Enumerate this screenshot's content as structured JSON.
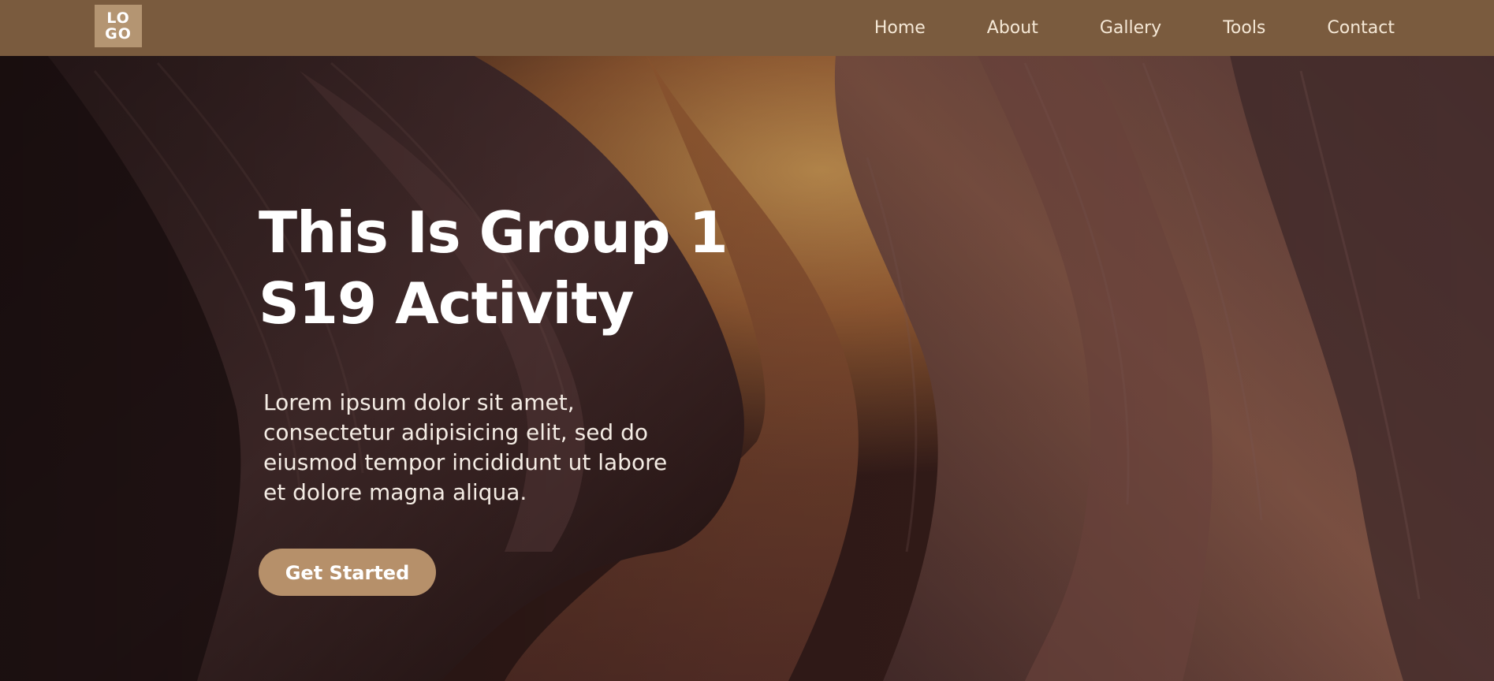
{
  "logo": {
    "line1": "LO",
    "line2": "GO"
  },
  "nav": {
    "items": [
      {
        "label": "Home"
      },
      {
        "label": "About"
      },
      {
        "label": "Gallery"
      },
      {
        "label": "Tools"
      },
      {
        "label": "Contact"
      }
    ]
  },
  "hero": {
    "title_line1": "This Is Group 1",
    "title_line2": "S19 Activity",
    "description": "Lorem ipsum dolor sit amet, consectetur adipisicing elit, sed do eiusmod tempor incididunt ut labore et dolore magna aliqua.",
    "cta_label": "Get Started"
  },
  "colors": {
    "navbar": "#7a5b3e",
    "logo_bg": "#b49572",
    "button": "#b6906a",
    "nav_text": "#f5e8d6"
  }
}
